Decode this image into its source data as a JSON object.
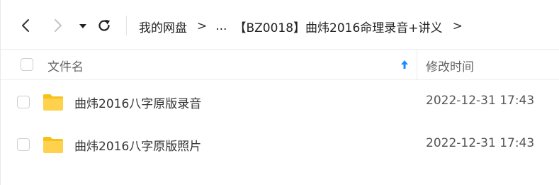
{
  "toolbar": {
    "back_icon": "chevron-left-icon",
    "forward_icon": "chevron-right-icon",
    "dropdown_icon": "caret-down-icon",
    "refresh_icon": "refresh-icon"
  },
  "breadcrumb": {
    "root": "我的网盘",
    "separator": ">",
    "ellipsis": "...",
    "current": "【BZ0018】曲炜2016命理录音+讲义"
  },
  "table": {
    "columns": {
      "name": "文件名",
      "modified": "修改时间"
    },
    "sort_icon": "sort-ascending-arrow-icon",
    "rows": [
      {
        "icon": "folder-icon",
        "name": "曲炜2016八字原版录音",
        "modified": "2022-12-31 17:43"
      },
      {
        "icon": "folder-icon",
        "name": "曲炜2016八字原版照片",
        "modified": "2022-12-31 17:43"
      }
    ]
  },
  "colors": {
    "accent": "#1a8cff",
    "folder": "#ffd24d",
    "folder_tab": "#f5c21b",
    "border": "#ececec"
  }
}
